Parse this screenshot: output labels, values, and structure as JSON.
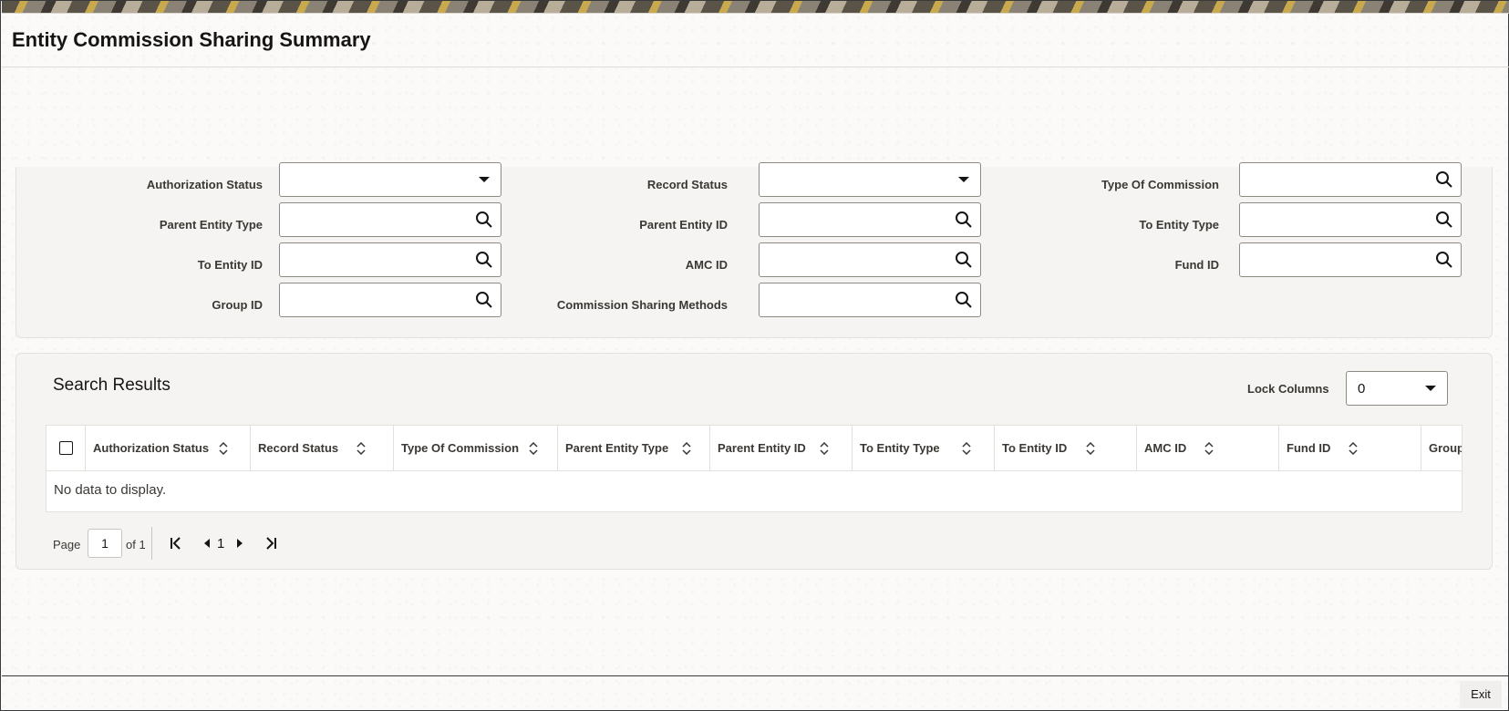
{
  "page": {
    "title": "Entity Commission Sharing Summary"
  },
  "search": {
    "authorization_status": {
      "label": "Authorization Status",
      "value": ""
    },
    "record_status": {
      "label": "Record Status",
      "value": ""
    },
    "type_of_commission": {
      "label": "Type Of Commission",
      "value": ""
    },
    "parent_entity_type": {
      "label": "Parent Entity Type",
      "value": ""
    },
    "parent_entity_id": {
      "label": "Parent Entity ID",
      "value": ""
    },
    "to_entity_type": {
      "label": "To Entity Type",
      "value": ""
    },
    "to_entity_id": {
      "label": "To Entity ID",
      "value": ""
    },
    "amc_id": {
      "label": "AMC ID",
      "value": ""
    },
    "fund_id": {
      "label": "Fund ID",
      "value": ""
    },
    "group_id": {
      "label": "Group ID",
      "value": ""
    },
    "commission_sharing_methods": {
      "label": "Commission Sharing Methods",
      "value": ""
    }
  },
  "results": {
    "title": "Search Results",
    "lock_columns_label": "Lock Columns",
    "lock_columns_value": "0",
    "columns": [
      "Authorization Status",
      "Record Status",
      "Type Of Commission",
      "Parent Entity Type",
      "Parent Entity ID",
      "To Entity Type",
      "To Entity ID",
      "AMC ID",
      "Fund ID",
      "Group"
    ],
    "empty_message": "No data to display."
  },
  "pagination": {
    "page_label": "Page",
    "current_page": "1",
    "of_label": "of 1",
    "current_indicator": "1"
  },
  "footer": {
    "exit_label": "Exit"
  },
  "icons": {
    "search": "search-icon",
    "dropdown": "chevron-down-icon",
    "sort": "sort-icon",
    "first": "first-page-icon",
    "prev": "previous-page-icon",
    "next": "next-page-icon",
    "last": "last-page-icon"
  }
}
